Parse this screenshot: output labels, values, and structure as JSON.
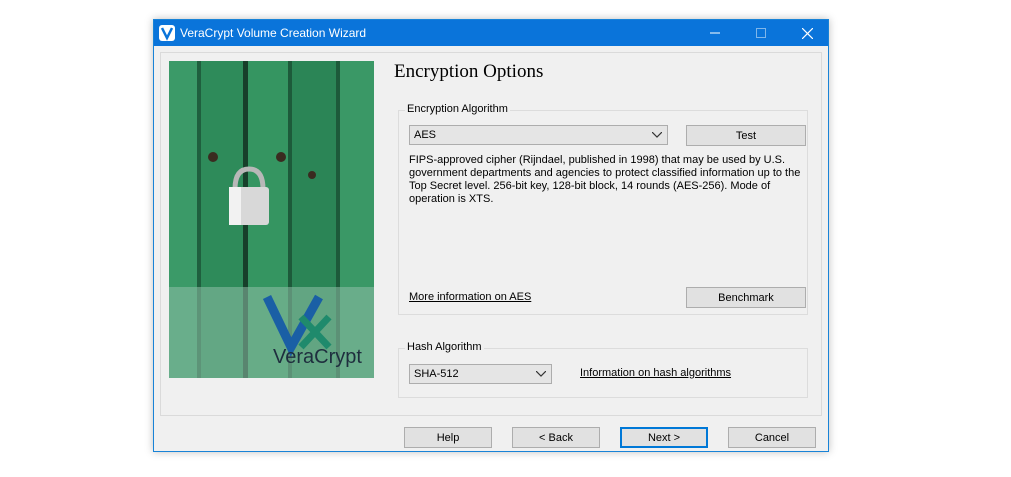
{
  "window": {
    "title": "VeraCrypt Volume Creation Wizard",
    "accent_color": "#0a74da"
  },
  "titlebar_buttons": [
    "minimize-icon",
    "maximize-icon",
    "close-icon"
  ],
  "page": {
    "title": "Encryption Options"
  },
  "banner": {
    "brand_text": "VeraCrypt"
  },
  "encryption": {
    "group_label": "Encryption Algorithm",
    "selected": "AES",
    "test_label": "Test",
    "description": "FIPS-approved cipher (Rijndael, published in 1998) that may be used by U.S. government departments and agencies to protect classified information up to the Top Secret level. 256-bit key, 128-bit block, 14 rounds (AES-256). Mode of operation is XTS.",
    "more_info_link": "More information on AES",
    "benchmark_label": "Benchmark"
  },
  "hash": {
    "group_label": "Hash Algorithm",
    "selected": "SHA-512",
    "info_link": "Information on hash algorithms"
  },
  "footer": {
    "help_label": "Help",
    "back_label": "< Back",
    "next_label": "Next >",
    "cancel_label": "Cancel"
  }
}
